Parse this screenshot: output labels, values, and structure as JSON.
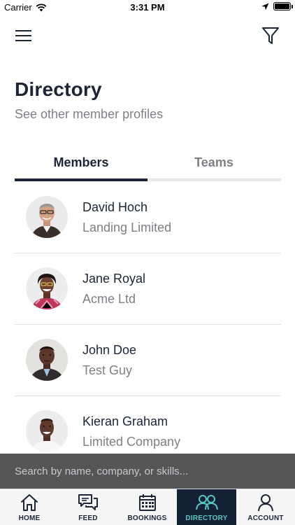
{
  "status_bar": {
    "carrier": "Carrier",
    "time": "3:31 PM"
  },
  "header": {
    "title": "Directory",
    "subtitle": "See other member profiles"
  },
  "tabs": [
    {
      "label": "Members",
      "active": true
    },
    {
      "label": "Teams",
      "active": false
    }
  ],
  "members": [
    {
      "name": "David Hoch",
      "company": "Landing Limited"
    },
    {
      "name": "Jane Royal",
      "company": "Acme Ltd"
    },
    {
      "name": "John Doe",
      "company": "Test Guy"
    },
    {
      "name": "Kieran Graham",
      "company": "Limited Company"
    }
  ],
  "search": {
    "placeholder": "Search by name, company, or skills..."
  },
  "nav": {
    "home": "HOME",
    "feed": "FEED",
    "bookings": "BOOKINGS",
    "directory": "DIRECTORY",
    "account": "ACCOUNT"
  },
  "colors": {
    "primary": "#1b2535",
    "accent": "#57c6c0",
    "nav_active_bg": "#142134",
    "search_bg": "#545557"
  },
  "icons": {
    "menu": "hamburger-icon",
    "filter": "filter-funnel-icon",
    "home": "house-icon",
    "feed": "chat-bubbles-icon",
    "bookings": "calendar-icon",
    "directory": "people-icon",
    "account": "person-icon"
  }
}
